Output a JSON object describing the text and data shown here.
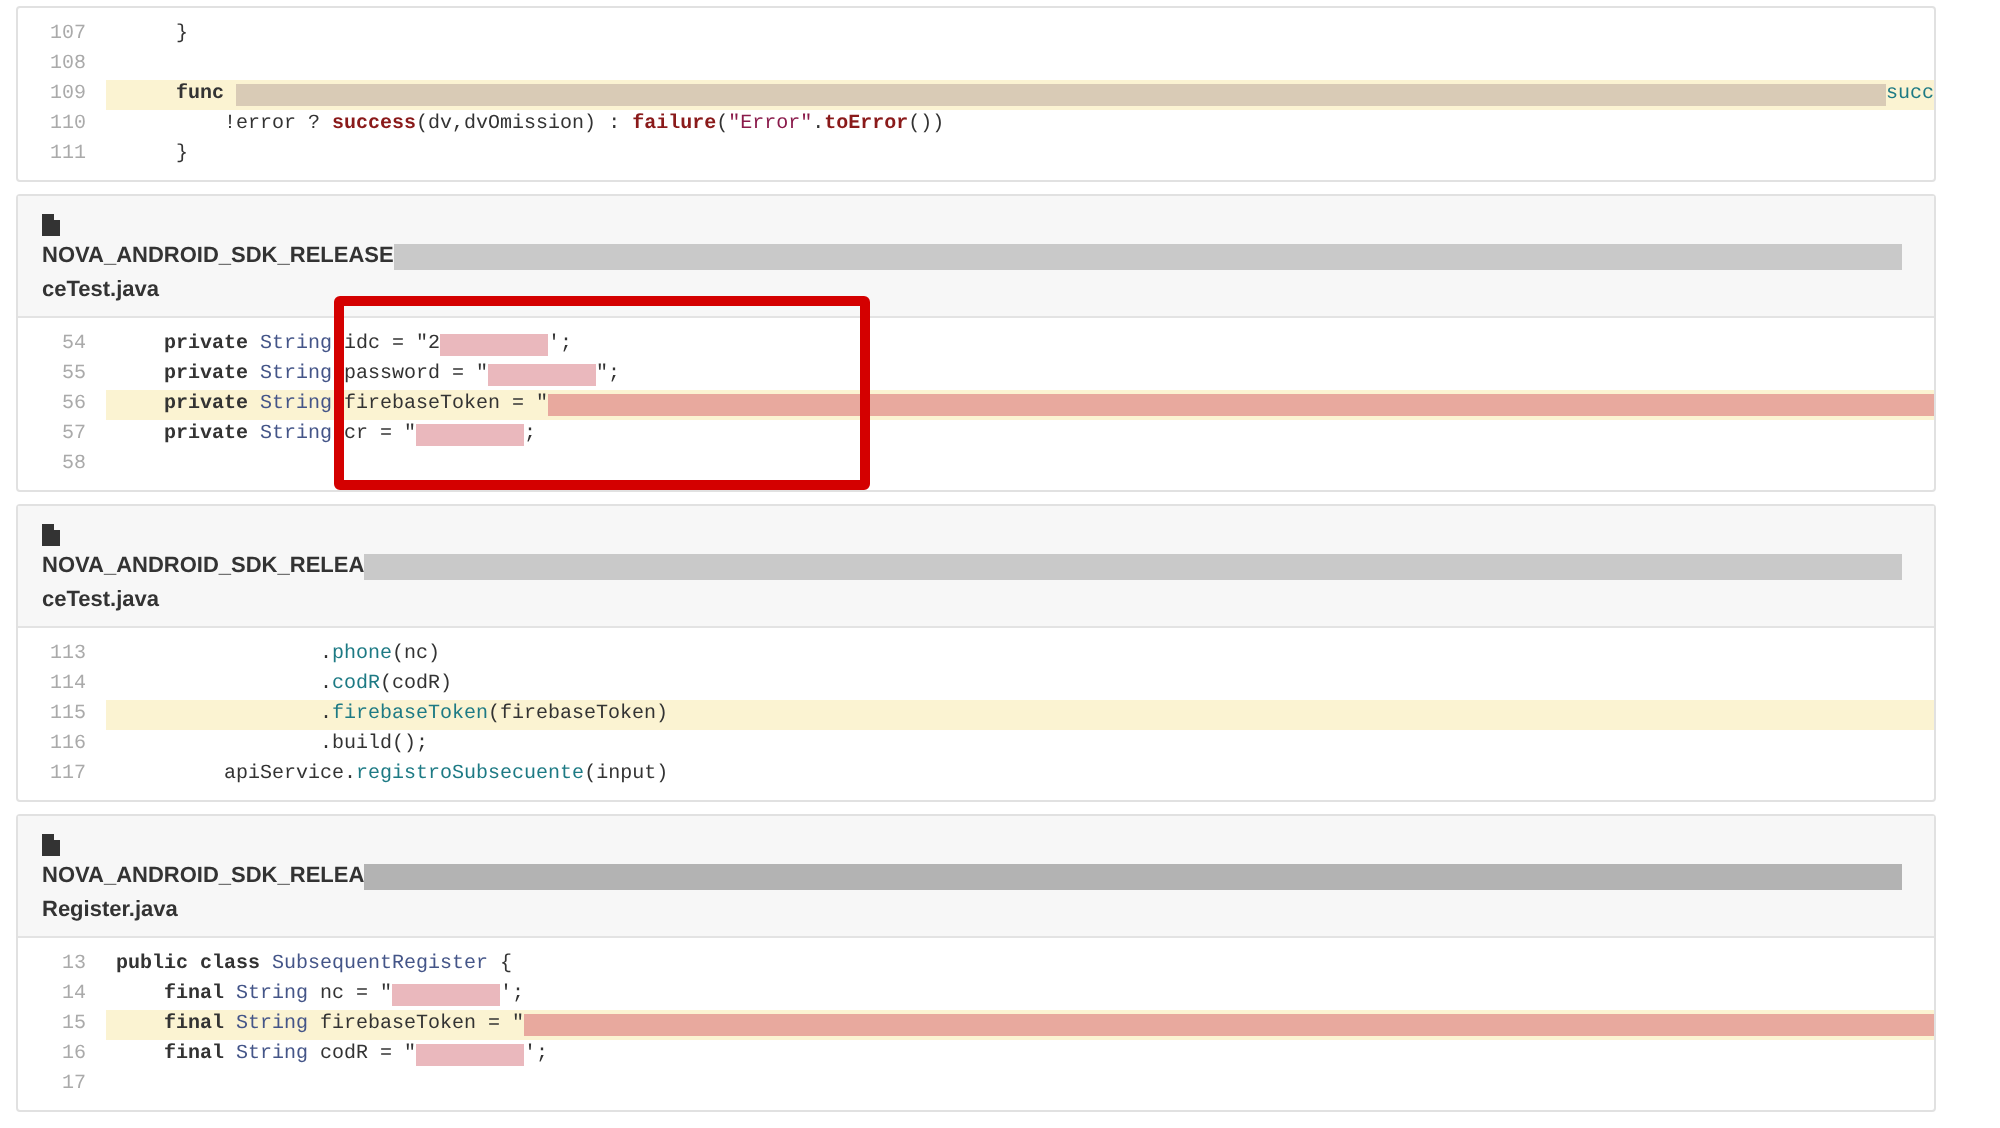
{
  "results": [
    {
      "lines": [
        {
          "number": "107",
          "highlighted": false,
          "tokens": [
            {
              "kind": "plain",
              "text": "     }"
            }
          ]
        },
        {
          "number": "108",
          "highlighted": false
        },
        {
          "number": "109",
          "highlighted": true,
          "tokens": [
            {
              "kind": "kw",
              "text": "     func "
            },
            {
              "kind": "redacted",
              "fills_line": true,
              "color": "#d9cbb6"
            },
            {
              "kind": "fn",
              "text": "succ"
            }
          ]
        },
        {
          "number": "110",
          "highlighted": false,
          "tokens": [
            {
              "kind": "plain",
              "text": "         !error ? "
            },
            {
              "kind": "call",
              "text": "success"
            },
            {
              "kind": "plain",
              "text": "(dv,dvOmission) : "
            },
            {
              "kind": "call",
              "text": "failure"
            },
            {
              "kind": "plain",
              "text": "("
            },
            {
              "kind": "str",
              "text": "\"Error\""
            },
            {
              "kind": "plain",
              "text": "."
            },
            {
              "kind": "call",
              "text": "toError"
            },
            {
              "kind": "plain",
              "text": "())"
            }
          ]
        },
        {
          "number": "111",
          "highlighted": false,
          "tokens": [
            {
              "kind": "plain",
              "text": "     }"
            }
          ]
        }
      ]
    },
    {
      "header": {
        "path": "NOVA_ANDROID_SDK_RELEASE",
        "path_redaction": {
          "color": "#c9c9c9"
        },
        "file_name": "ceTest.java"
      },
      "callout_frame": true,
      "lines": [
        {
          "number": "54",
          "highlighted": false,
          "tokens": [
            {
              "kind": "kw",
              "text": "    private "
            },
            {
              "kind": "type",
              "text": "String"
            },
            {
              "kind": "plain",
              "text": " idc = \"2"
            },
            {
              "kind": "redacted",
              "fills_line": false,
              "color": "#eab8bd"
            },
            {
              "kind": "plain",
              "text": "';"
            }
          ]
        },
        {
          "number": "55",
          "highlighted": false,
          "tokens": [
            {
              "kind": "kw",
              "text": "    private "
            },
            {
              "kind": "type",
              "text": "String"
            },
            {
              "kind": "plain",
              "text": " password = \""
            },
            {
              "kind": "redacted",
              "fills_line": false,
              "color": "#eab8bd"
            },
            {
              "kind": "plain",
              "text": "\";"
            }
          ]
        },
        {
          "number": "56",
          "highlighted": true,
          "tokens": [
            {
              "kind": "kw",
              "text": "    private "
            },
            {
              "kind": "type",
              "text": "String"
            },
            {
              "kind": "plain",
              "text": " firebaseToken = \""
            },
            {
              "kind": "redacted",
              "fills_line": true,
              "color": "#e8a99e"
            }
          ]
        },
        {
          "number": "57",
          "highlighted": false,
          "tokens": [
            {
              "kind": "kw",
              "text": "    private "
            },
            {
              "kind": "type",
              "text": "String"
            },
            {
              "kind": "plain",
              "text": " cr = \""
            },
            {
              "kind": "redacted",
              "fills_line": false,
              "color": "#eab8bd"
            },
            {
              "kind": "plain",
              "text": ";"
            }
          ]
        },
        {
          "number": "58",
          "highlighted": false
        }
      ]
    },
    {
      "header": {
        "path": "NOVA_ANDROID_SDK_RELEA",
        "path_redaction": {
          "color": "#c9c9c9"
        },
        "file_name": "ceTest.java"
      },
      "lines": [
        {
          "number": "113",
          "highlighted": false,
          "tokens": [
            {
              "kind": "plain",
              "text": "                 ."
            },
            {
              "kind": "fn",
              "text": "phone"
            },
            {
              "kind": "plain",
              "text": "(nc)"
            }
          ]
        },
        {
          "number": "114",
          "highlighted": false,
          "tokens": [
            {
              "kind": "plain",
              "text": "                 ."
            },
            {
              "kind": "fn",
              "text": "codR"
            },
            {
              "kind": "plain",
              "text": "(codR)"
            }
          ]
        },
        {
          "number": "115",
          "highlighted": true,
          "tokens": [
            {
              "kind": "plain",
              "text": "                 ."
            },
            {
              "kind": "fn",
              "text": "firebaseToken"
            },
            {
              "kind": "plain",
              "text": "(firebaseToken)"
            }
          ]
        },
        {
          "number": "116",
          "highlighted": false,
          "tokens": [
            {
              "kind": "plain",
              "text": "                 .build();"
            }
          ]
        },
        {
          "number": "117",
          "highlighted": false,
          "tokens": [
            {
              "kind": "plain",
              "text": "         apiService."
            },
            {
              "kind": "fn",
              "text": "registroSubsecuente"
            },
            {
              "kind": "plain",
              "text": "(input)"
            }
          ]
        }
      ]
    },
    {
      "header": {
        "path": "NOVA_ANDROID_SDK_RELEA",
        "path_redaction": {
          "color": "#b3b3b3"
        },
        "file_name": "Register.java"
      },
      "lines": [
        {
          "number": "13",
          "highlighted": false,
          "tokens": [
            {
              "kind": "kw",
              "text": "public class "
            },
            {
              "kind": "type",
              "text": "SubsequentRegister"
            },
            {
              "kind": "plain",
              "text": " {"
            }
          ]
        },
        {
          "number": "14",
          "highlighted": false,
          "tokens": [
            {
              "kind": "kw",
              "text": "    final "
            },
            {
              "kind": "type",
              "text": "String"
            },
            {
              "kind": "plain",
              "text": " nc = \""
            },
            {
              "kind": "redacted",
              "fills_line": false,
              "color": "#eab8bd"
            },
            {
              "kind": "plain",
              "text": "';"
            }
          ]
        },
        {
          "number": "15",
          "highlighted": true,
          "tokens": [
            {
              "kind": "kw",
              "text": "    final "
            },
            {
              "kind": "type",
              "text": "String"
            },
            {
              "kind": "plain",
              "text": " firebaseToken = \""
            },
            {
              "kind": "redacted",
              "fills_line": true,
              "color": "#e8a99e"
            }
          ]
        },
        {
          "number": "16",
          "highlighted": false,
          "tokens": [
            {
              "kind": "kw",
              "text": "    final "
            },
            {
              "kind": "type",
              "text": "String"
            },
            {
              "kind": "plain",
              "text": " codR = \""
            },
            {
              "kind": "redacted",
              "fills_line": false,
              "color": "#eab8bd"
            },
            {
              "kind": "plain",
              "text": "';"
            }
          ]
        },
        {
          "number": "17",
          "highlighted": false
        }
      ]
    }
  ]
}
